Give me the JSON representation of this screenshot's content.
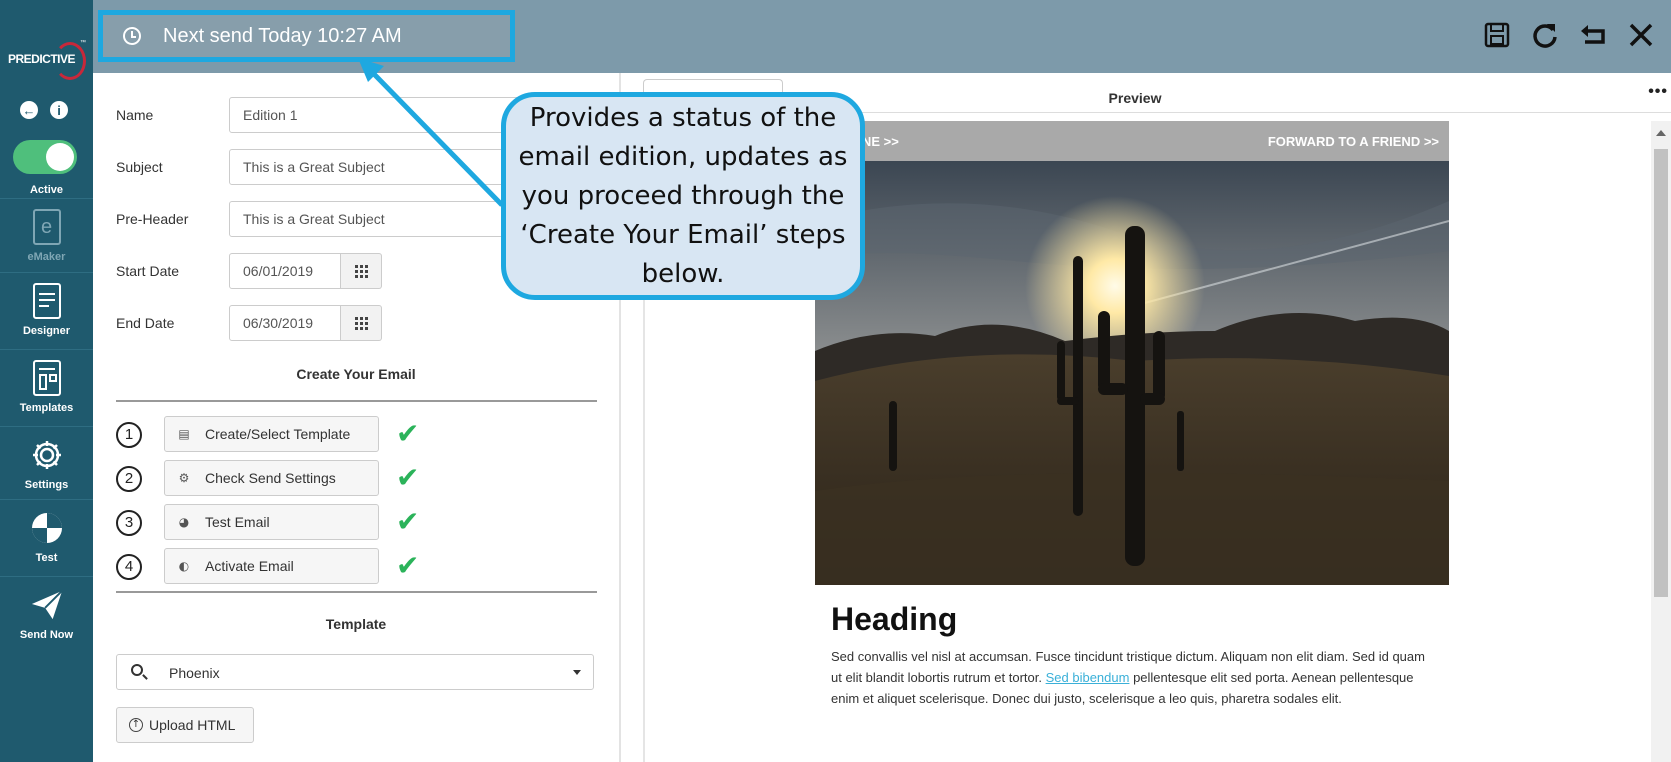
{
  "topbar": {
    "next_send": "Next send Today 10:27 AM"
  },
  "sidebar": {
    "logo_text": "PREDICTIVE",
    "logo_tm": "™",
    "active_label": "Active",
    "items": [
      {
        "label": "eMaker",
        "icon": "emaker-icon",
        "enabled": false
      },
      {
        "label": "Designer",
        "icon": "designer-icon",
        "enabled": true
      },
      {
        "label": "Templates",
        "icon": "templates-icon",
        "enabled": true
      },
      {
        "label": "Settings",
        "icon": "gear-icon",
        "enabled": true
      },
      {
        "label": "Test",
        "icon": "test-icon",
        "enabled": true
      },
      {
        "label": "Send Now",
        "icon": "paper-plane-icon",
        "enabled": true
      }
    ]
  },
  "form": {
    "name_label": "Name",
    "name_value": "Edition 1",
    "subject_label": "Subject",
    "subject_value": "This is a Great Subject",
    "preheader_label": "Pre-Header",
    "preheader_value": "This is a Great Subject",
    "start_label": "Start Date",
    "start_value": "06/01/2019",
    "end_label": "End Date",
    "end_value": "06/30/2019"
  },
  "create_email": {
    "title": "Create Your Email",
    "steps": [
      {
        "num": "1",
        "label": "Create/Select Template",
        "complete": true
      },
      {
        "num": "2",
        "label": "Check Send Settings",
        "complete": true
      },
      {
        "num": "3",
        "label": "Test Email",
        "complete": true
      },
      {
        "num": "4",
        "label": "Activate Email",
        "complete": true
      }
    ]
  },
  "template": {
    "title": "Template",
    "selected": "Phoenix",
    "upload_label": "Upload HTML"
  },
  "preview": {
    "title": "Preview",
    "more": "•••",
    "email": {
      "view_online": "W ONLINE >>",
      "forward": "FORWARD TO A FRIEND >>",
      "heading": "Heading",
      "body_before_link": "Sed convallis vel nisl at accumsan. Fusce tincidunt tristique dictum. Aliquam non elit diam. Sed id quam ut elit blandit lobortis rutrum et tortor. ",
      "link_text": "Sed bibendum",
      "body_after_link": " pellentesque elit sed porta. Aenean pellentesque enim et aliquet scelerisque. Donec dui justo, scelerisque a leo quis, pharetra sodales elit."
    }
  },
  "callout": {
    "text": "Provides a status of the email edition, updates as you proceed through the ‘Create Your Email’ steps below."
  },
  "colors": {
    "sidebar": "#1f5a6e",
    "topbar": "#7d9aaa",
    "highlight": "#1ea8e0",
    "toggle_on": "#4fbf7c",
    "check": "#2bb35a"
  }
}
